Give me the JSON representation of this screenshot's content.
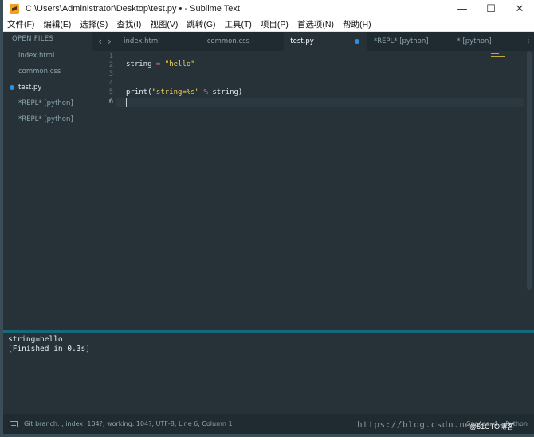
{
  "window": {
    "title": "C:\\Users\\Administrator\\Desktop\\test.py • - Sublime Text",
    "controls": {
      "minimize": "—",
      "maximize": "☐",
      "close": "✕"
    }
  },
  "menu": [
    "文件(F)",
    "编辑(E)",
    "选择(S)",
    "查找(I)",
    "视图(V)",
    "跳转(G)",
    "工具(T)",
    "项目(P)",
    "首选项(N)",
    "帮助(H)"
  ],
  "sidebar": {
    "header": "OPEN FILES",
    "files": [
      {
        "label": "index.html",
        "active": false
      },
      {
        "label": "common.css",
        "active": false
      },
      {
        "label": "test.py",
        "active": true
      },
      {
        "label": "*REPL* [python]",
        "active": false
      },
      {
        "label": "*REPL* [python]",
        "active": false
      }
    ]
  },
  "tabs": {
    "prev_icon": "‹",
    "next_icon": "›",
    "items": [
      {
        "label": "index.html",
        "active": false
      },
      {
        "label": "common.css",
        "active": false
      },
      {
        "label": "test.py",
        "active": true,
        "dirty": true
      },
      {
        "label": "*REPL* [python]",
        "active": false
      },
      {
        "label": "* [python]",
        "active": false
      }
    ],
    "more_icon": "⋮"
  },
  "editor": {
    "line_numbers": [
      "1",
      "2",
      "3",
      "4",
      "5",
      "6"
    ],
    "current_line": "6",
    "line2": {
      "var": "string",
      "op": " = ",
      "str": "\"hello\""
    },
    "line5": {
      "fn": "print(",
      "str": "\"string=%s\"",
      "op": " % ",
      "rest": "string)"
    }
  },
  "output": {
    "lines": [
      "string=hello",
      "[Finished in 0.3s]"
    ]
  },
  "statusbar": {
    "left": "Git branch: , index: 104?, working: 104?, UTF-8, Line 6, Column 1",
    "right_spaces": "Spaces: 4",
    "right_syntax": "Python"
  },
  "watermark": {
    "url": "https://blog.csdn.net/",
    "brand": "@51CTO博客"
  },
  "colors": {
    "background": "#263238",
    "accent": "#16687b",
    "string": "#f0d25a",
    "dirty_dot": "#2d8fe3"
  }
}
